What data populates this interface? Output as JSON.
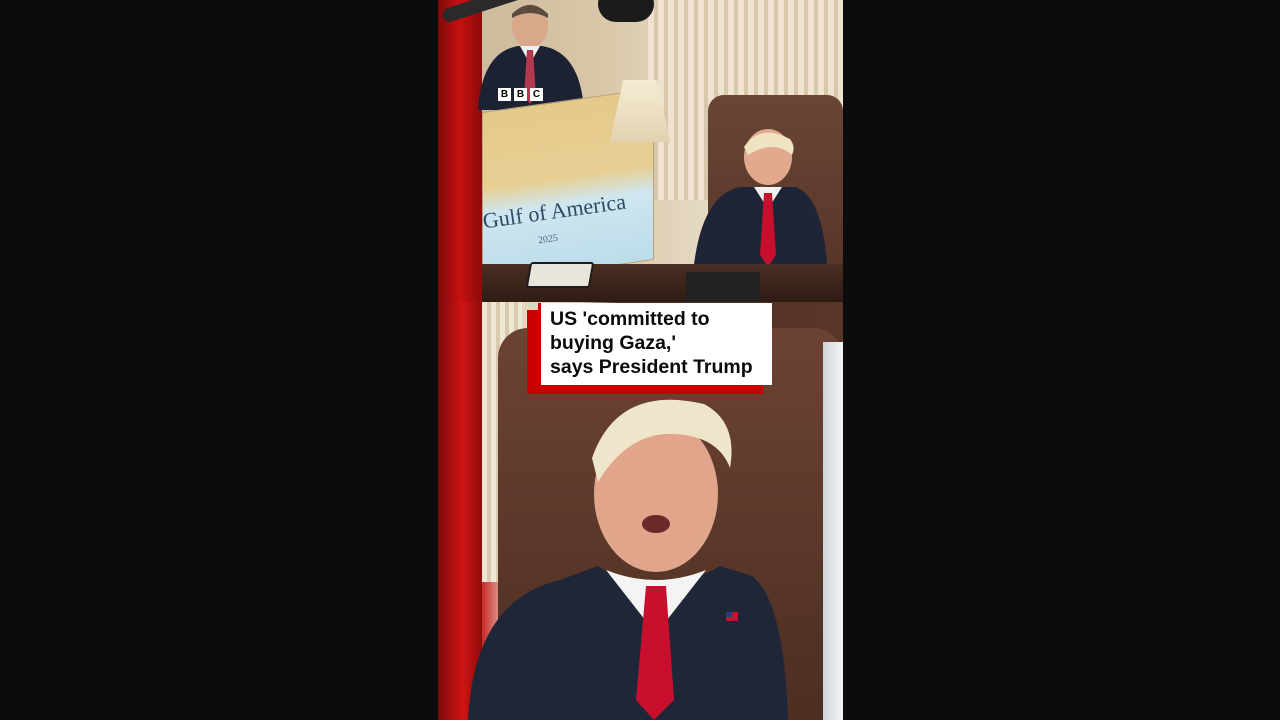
{
  "video": {
    "brand_letters": [
      "B",
      "B",
      "C"
    ],
    "map_title": "Gulf of America",
    "map_subtitle": "2025"
  },
  "caption": {
    "lines": [
      "US 'committed to",
      "buying Gaza,'",
      "says President Trump"
    ]
  },
  "colors": {
    "background": "#0c0c0c",
    "caption_accent": "#c80000",
    "caption_box": "#ffffff",
    "caption_text": "#0b0b0b"
  },
  "icons": {
    "brand": "bbc-logo-icon"
  }
}
